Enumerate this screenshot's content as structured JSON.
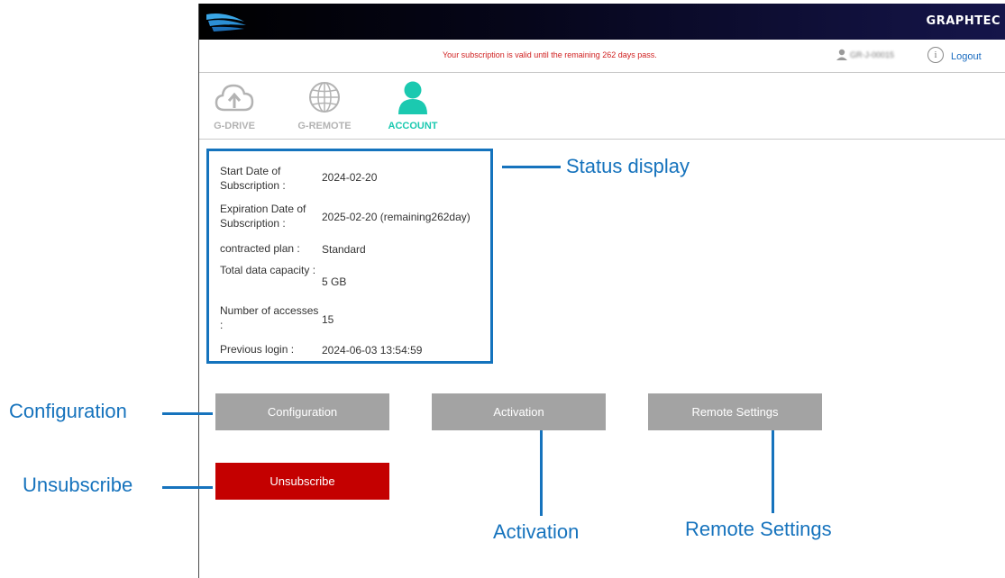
{
  "brand": "GRAPHTEC",
  "subscription_message": "Your subscription is valid until the remaining 262 days pass.",
  "user_name": "GR-J-00015",
  "info_glyph": "i",
  "logout_label": "Logout",
  "nav": [
    {
      "label": "G-DRIVE",
      "icon": "cloud-upload-icon",
      "active": false
    },
    {
      "label": "G-REMOTE",
      "icon": "globe-icon",
      "active": false
    },
    {
      "label": "ACCOUNT",
      "icon": "user-icon",
      "active": true
    }
  ],
  "status": [
    {
      "key": "Start Date of Subscription :",
      "value": "2024-02-20"
    },
    {
      "key": "Expiration Date of Subscription :",
      "value": "2025-02-20 (remaining262day)"
    },
    {
      "key": "contracted plan :",
      "value": "Standard"
    },
    {
      "key": "Total data capacity :",
      "value": "5 GB"
    },
    {
      "key": "Number of accesses :",
      "value": "15"
    },
    {
      "key": "Previous login :",
      "value": "2024-06-03 13:54:59"
    }
  ],
  "buttons": {
    "configuration": "Configuration",
    "activation": "Activation",
    "remote_settings": "Remote Settings",
    "unsubscribe": "Unsubscribe"
  },
  "callouts": {
    "status_display": "Status display",
    "configuration": "Configuration",
    "unsubscribe": "Unsubscribe",
    "activation": "Activation",
    "remote_settings": "Remote Settings"
  },
  "colors": {
    "accent": "#1bc9b0",
    "callout_blue": "#1673bd",
    "button_gray": "#a3a3a3",
    "button_red": "#c40000",
    "warning_red": "#d01f1f"
  }
}
